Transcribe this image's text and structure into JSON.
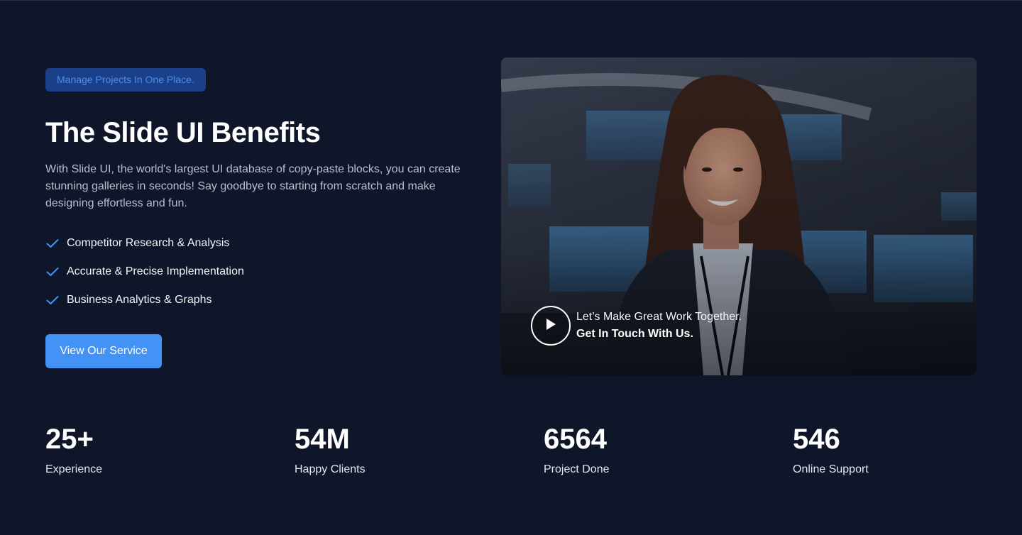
{
  "hero": {
    "badge": "Manage Projects In One Place.",
    "title": "The Slide UI Benefits",
    "description": "With Slide UI, the world's largest UI database of copy-paste blocks, you can create stunning galleries in seconds! Say goodbye to starting from scratch and make designing effortless and fun.",
    "features": [
      "Competitor Research & Analysis",
      "Accurate & Precise Implementation",
      "Business Analytics & Graphs"
    ],
    "cta_label": "View Our Service",
    "accent_color": "#4392f6"
  },
  "video": {
    "line1": "Let’s Make Great Work Together.",
    "line2": "Get In Touch With Us.",
    "play_icon": "play-icon"
  },
  "stats": [
    {
      "value": "25+",
      "label": "Experience"
    },
    {
      "value": "54M",
      "label": "Happy Clients"
    },
    {
      "value": "6564",
      "label": "Project Done"
    },
    {
      "value": "546",
      "label": "Online Support"
    }
  ]
}
